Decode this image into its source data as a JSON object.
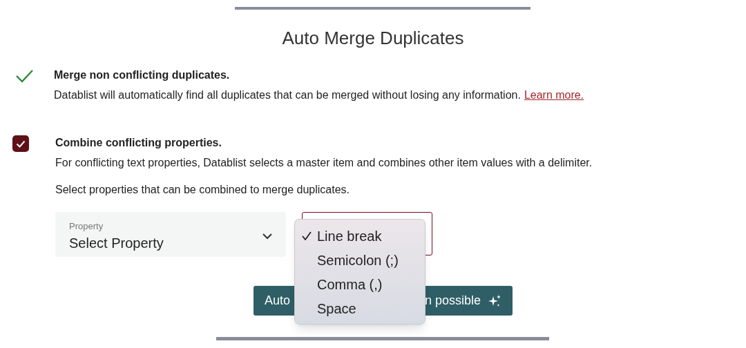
{
  "title": "Auto Merge Duplicates",
  "options": [
    {
      "kind": "done",
      "checked": true,
      "heading": "Merge non conflicting duplicates.",
      "description": "Datablist will automatically find all duplicates that can be merged without losing any information.",
      "link": "Learn more."
    },
    {
      "kind": "checkbox",
      "checked": true,
      "heading": "Combine conflicting properties.",
      "description": "For conflicting text properties, Datablist selects a master item and combines other item values with a delimiter."
    }
  ],
  "hint": "Select properties that can be combined to merge duplicates.",
  "property_field": {
    "label": "Property",
    "value": "Select Property"
  },
  "delimiter_menu": [
    {
      "label": "Line break",
      "selected": true
    },
    {
      "label": "Semicolon (;)",
      "selected": false
    },
    {
      "label": "Comma (,)",
      "selected": false
    },
    {
      "label": "Space",
      "selected": false
    }
  ],
  "action_button": {
    "label_start": "Auto",
    "label_end": "n possible"
  }
}
